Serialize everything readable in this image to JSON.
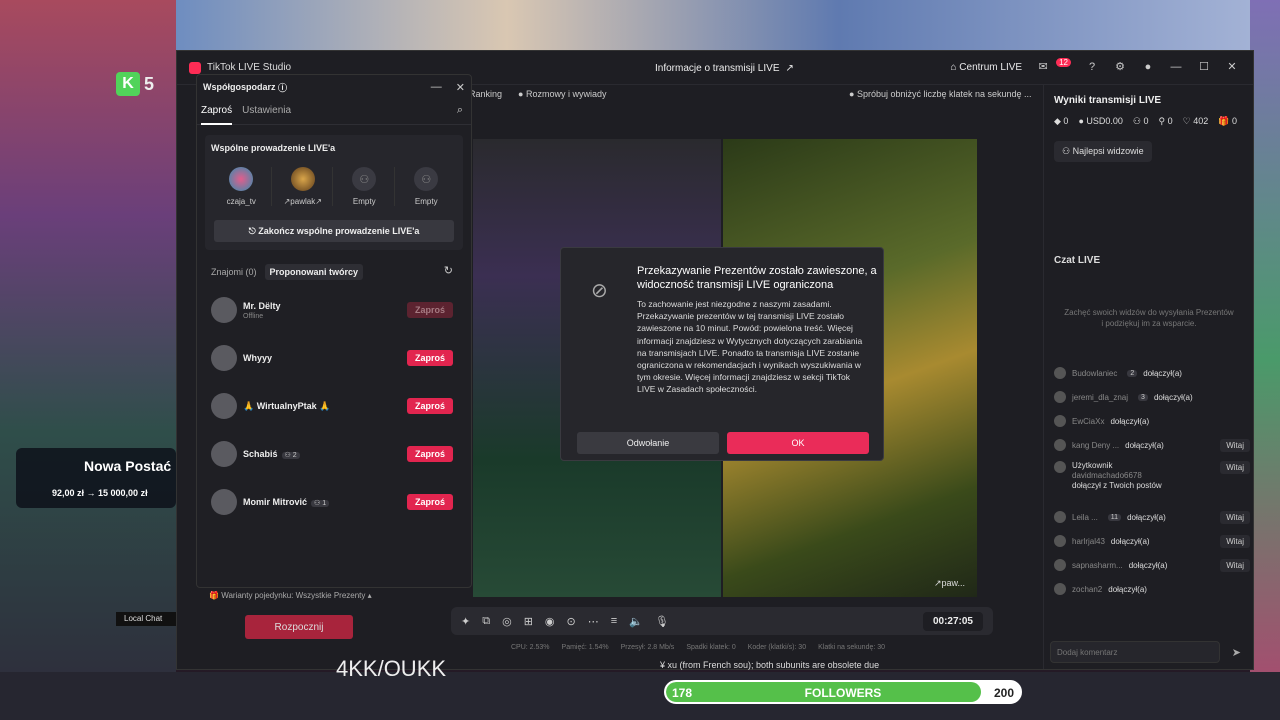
{
  "window": {
    "app_title": "TikTok LIVE Studio",
    "center_title": "Informacje o transmisji LIVE",
    "centrum": "Centrum LIVE",
    "notif_count": "12"
  },
  "toolbar": {
    "ranking": "Ranking",
    "talks": "Rozmowy i wywiady",
    "hint": "Spróbuj obniżyć liczbę klatek na sekundę ..."
  },
  "cohost": {
    "title": "Współgospodarz",
    "tabs": [
      "Zaproś",
      "Ustawienia"
    ],
    "card_title": "Wspólne prowadzenie LIVE'a",
    "slots": [
      {
        "name": "czaja_tv"
      },
      {
        "name": "↗pawlak↗"
      },
      {
        "name": "Empty"
      },
      {
        "name": "Empty"
      }
    ],
    "end_button": "Zakończ wspólne prowadzenie LIVE'a",
    "friends_tab": "Znajomi (0)",
    "suggested_tab": "Proponowani twórcy",
    "invite_label": "Zaproś",
    "creators": [
      {
        "name": "Mr. Dëlty",
        "sub": "Offline",
        "count": "",
        "disabled": true
      },
      {
        "name": "Whyyy",
        "sub": "",
        "count": "",
        "disabled": false
      },
      {
        "name": "🙏 WirtualnyPtak 🙏",
        "sub": "",
        "count": "",
        "disabled": false
      },
      {
        "name": "Schabiś",
        "sub": "",
        "count": "2",
        "disabled": false
      },
      {
        "name": "Momir Mitrović",
        "sub": "",
        "count": "1",
        "disabled": false
      }
    ]
  },
  "modal": {
    "title": "Przekazywanie Prezentów zostało zawieszone, a widoczność transmisji LIVE ograniczona",
    "body": "To zachowanie jest niezgodne z naszymi zasadami. Przekazywanie prezentów w tej transmisji LIVE zostało zawieszone na 10 minut. Powód: powielona treść. Więcej informacji znajdziesz w Wytycznych dotyczących zarabiania na transmisjach LIVE. Ponadto ta transmisja LIVE zostanie ograniczona w rekomendacjach i wynikach wyszukiwania w tym okresie. Więcej informacji znajdziesz w sekcji TikTok LIVE w Zasadach społeczności.",
    "cancel": "Odwołanie",
    "ok": "OK"
  },
  "results": {
    "title": "Wyniki transmisji LIVE",
    "diamonds": "0",
    "usd": "USD0.00",
    "viewers": "0",
    "shares": "0",
    "likes": "402",
    "gifts": "0",
    "top_viewers": "Najlepsi widzowie"
  },
  "chat": {
    "title": "Czat LIVE",
    "hint": "Zachęć swoich widzów do wysyłania Prezentów i podziękuj im za wsparcie.",
    "joined": "dołączył(a)",
    "witaj": "Witaj",
    "rows": [
      {
        "name": "Budowlaniec",
        "badge": "2",
        "witaj": false
      },
      {
        "name": "jeremi_dla_znaj",
        "badge": "3",
        "witaj": false
      },
      {
        "name": "EwCiaXx",
        "badge": "",
        "witaj": false
      },
      {
        "name": "kang Deny ...",
        "badge": "",
        "witaj": true
      },
      {
        "name": "Leila ...",
        "badge": "11",
        "witaj": true
      },
      {
        "name": "harlrjal43",
        "badge": "",
        "witaj": true
      },
      {
        "name": "sapnasharm...",
        "badge": "",
        "witaj": true
      },
      {
        "name": "zochan2",
        "badge": "",
        "witaj": false
      }
    ],
    "follower_user": "Użytkownik",
    "follower_handle": "davidmachado6678",
    "follower_text": "dołączył z Twoich postów",
    "input_placeholder": "Dodaj komentarz"
  },
  "stream": {
    "timer": "00:27:05",
    "video_label": "↗paw...",
    "stats": [
      "CPU: 2.53%",
      "Pamięć: 1.54%",
      "Przesył: 2.8 Mb/s",
      "Spadki klatek: 0",
      "Koder (klatki/s): 30",
      "Klatki na sekundę: 30"
    ],
    "duel": "Warianty pojedynku: Wszystkie Prezenty",
    "start": "Rozpocznij"
  },
  "overlay": {
    "k_count": "5",
    "promo_title": "Nowa Postać",
    "promo_sub": "92,00 zł → 15 000,00 zł",
    "local_chat": "Local Chat",
    "ticker": "¥ xu (from French sou); both subunits are obsolete due",
    "followers_label": "FOLLOWERS",
    "followers_current": 178,
    "followers_goal": 200,
    "followers_progress": 0.89,
    "bigtext": "4KK/OUKK"
  },
  "colors": {
    "accent": "#ea2c59",
    "green": "#55c04a"
  }
}
